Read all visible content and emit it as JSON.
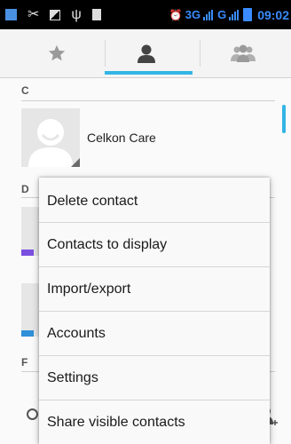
{
  "status_bar": {
    "network_label": "3G",
    "second_network_label": "G",
    "time": "09:02",
    "accent_color": "#3a8cff",
    "icons": [
      "app-icon",
      "missed-call-icon",
      "image-icon",
      "usb-icon",
      "storage-icon",
      "alarm-icon",
      "signal-icon",
      "battery-icon"
    ]
  },
  "tabs": [
    {
      "name": "favorites",
      "icon": "star-icon",
      "selected": false
    },
    {
      "name": "contacts",
      "icon": "person-icon",
      "selected": true
    },
    {
      "name": "groups",
      "icon": "group-icon",
      "selected": false
    }
  ],
  "accent_color": "#33b5e5",
  "list": {
    "sections": [
      {
        "header": "C",
        "contacts": [
          {
            "name": "Celkon Care"
          }
        ]
      },
      {
        "header": "D",
        "contacts": []
      },
      {
        "header": "F",
        "contacts": []
      }
    ]
  },
  "menu": {
    "items": [
      {
        "label": "Delete contact"
      },
      {
        "label": "Contacts to display"
      },
      {
        "label": "Import/export"
      },
      {
        "label": "Accounts"
      },
      {
        "label": "Settings"
      },
      {
        "label": "Share visible contacts"
      }
    ]
  },
  "bottom_bar": {
    "icons": [
      "search-icon",
      "add-contact-icon"
    ]
  }
}
